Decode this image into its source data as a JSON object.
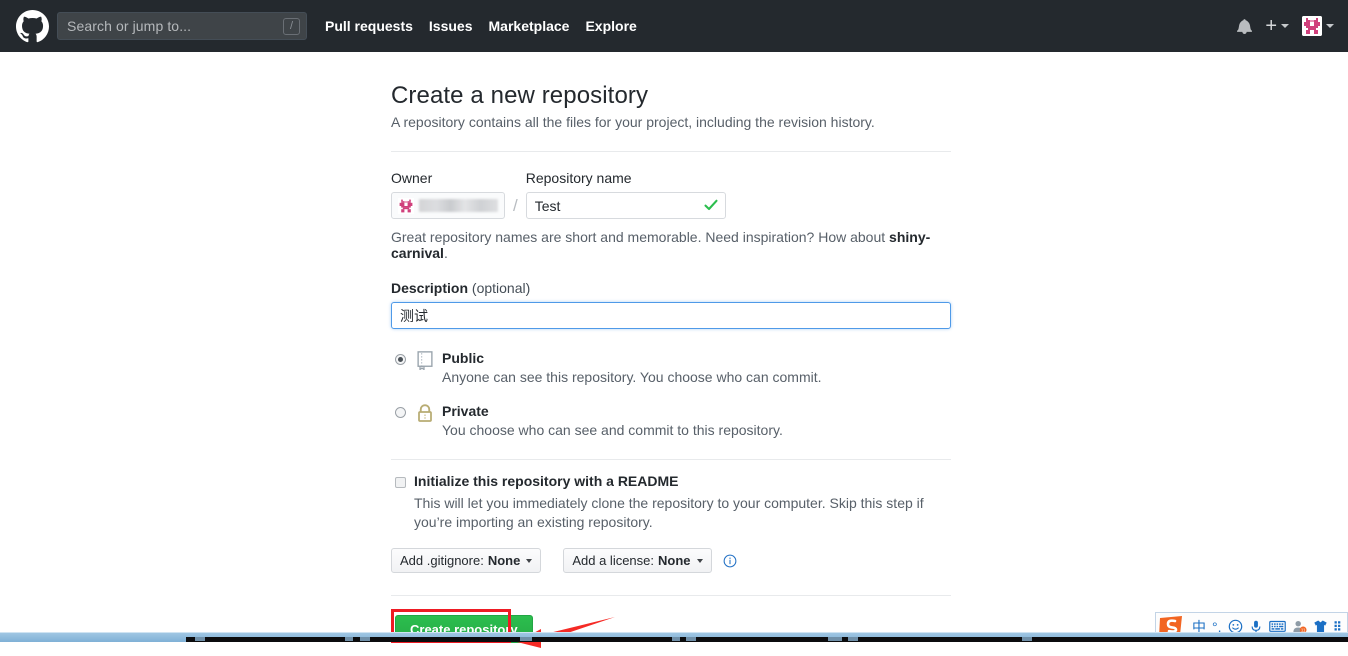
{
  "header": {
    "logo_icon": "github-mark-icon",
    "search": {
      "placeholder": "Search or jump to...",
      "shortcut_key": "/"
    },
    "nav": [
      {
        "label": "Pull requests"
      },
      {
        "label": "Issues"
      },
      {
        "label": "Marketplace"
      },
      {
        "label": "Explore"
      }
    ],
    "right": {
      "bell_icon": "bell-icon",
      "plus_label": "+",
      "avatar_icon": "user-identicon-avatar",
      "bg_color": "#24292e"
    }
  },
  "main": {
    "title": "Create a new repository",
    "subtitle": "A repository contains all the files for your project, including the revision history.",
    "owner": {
      "label": "Owner",
      "value_redacted": true,
      "identicon_icon": "owner-identicon-icon",
      "separator": "/"
    },
    "repository_name": {
      "label": "Repository name",
      "value": "Test",
      "placeholder": "",
      "valid_icon": "check-icon",
      "valid_color": "#28a745"
    },
    "name_hint": {
      "text_before": "Great repository names are short and memorable. Need inspiration? How about ",
      "suggestion": "shiny-carnival",
      "text_after": "."
    },
    "description": {
      "label_strong": "Description",
      "label_optional": "(optional)",
      "value": "测试",
      "placeholder": "",
      "focused": true,
      "focus_color": "#4f9ae8"
    },
    "visibility": [
      {
        "id": "public",
        "title": "Public",
        "desc": "Anyone can see this repository. You choose who can commit.",
        "icon": "book-icon",
        "selected": true
      },
      {
        "id": "private",
        "title": "Private",
        "desc": "You choose who can see and commit to this repository.",
        "icon": "lock-icon",
        "selected": false
      }
    ],
    "readme": {
      "title": "Initialize this repository with a README",
      "desc": "This will let you immediately clone the repository to your computer. Skip this step if you’re importing an existing repository.",
      "checked": false
    },
    "dropdowns": [
      {
        "prefix": "Add .gitignore:",
        "value": "None"
      },
      {
        "prefix": "Add a license:",
        "value": "None"
      }
    ],
    "info_icon": "info-icon",
    "create_button": {
      "label": "Create repository",
      "color": "#2cbe4e"
    },
    "annotations": {
      "highlight_color": "#ee1b24",
      "arrow_color": "#f52a25",
      "arrow_icon": "left-arrow-annotation-icon",
      "rect_icon": "highlight-rectangle-annotation-icon"
    }
  },
  "ime_toolbar": {
    "logo_icon": "sogou-pinyin-logo-icon",
    "items": [
      {
        "icon": "chinese-mode-icon",
        "label": "中"
      },
      {
        "icon": "punctuation-mode-icon",
        "label": "°,"
      },
      {
        "icon": "emoji-icon",
        "label": ""
      },
      {
        "icon": "microphone-icon",
        "label": ""
      },
      {
        "icon": "soft-keyboard-icon",
        "label": ""
      },
      {
        "icon": "user-account-icon",
        "label": ""
      },
      {
        "icon": "skin-shirt-icon",
        "label": ""
      },
      {
        "icon": "toolbox-menu-icon",
        "label": ""
      }
    ]
  }
}
